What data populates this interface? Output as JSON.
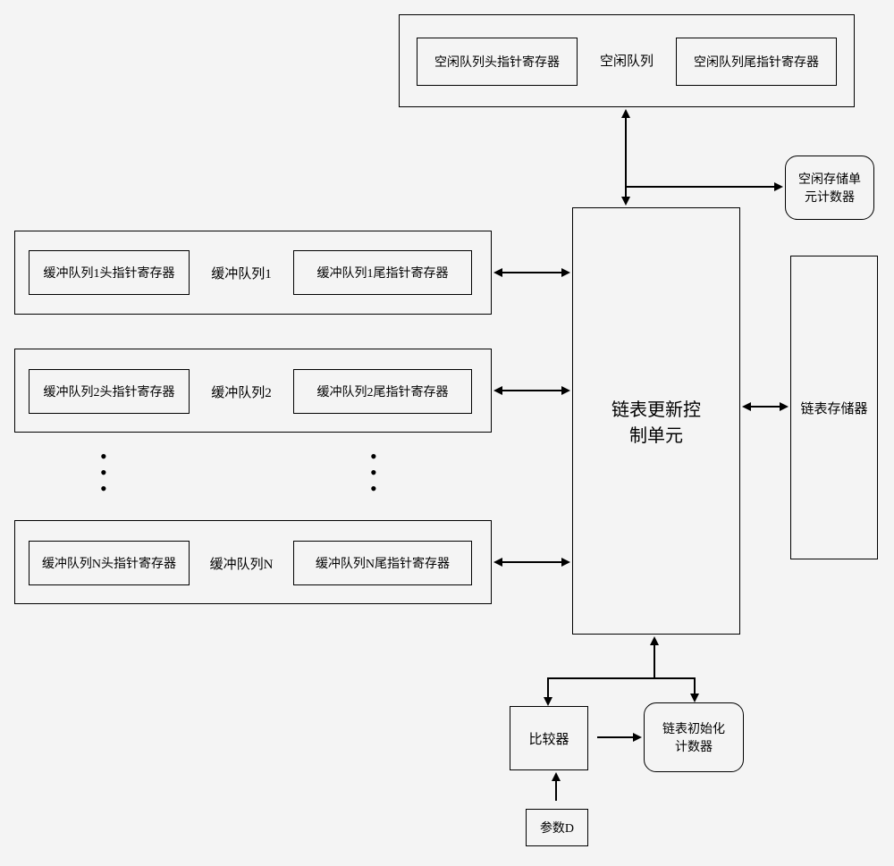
{
  "idleQueue": {
    "container": "",
    "headReg": "空闲队列头指针寄存器",
    "label": "空闲队列",
    "tailReg": "空闲队列尾指针寄存器"
  },
  "bufferQueues": [
    {
      "container": "",
      "headReg": "缓冲队列1头指针寄存器",
      "label": "缓冲队列1",
      "tailReg": "缓冲队列1尾指针寄存器"
    },
    {
      "container": "",
      "headReg": "缓冲队列2头指针寄存器",
      "label": "缓冲队列2",
      "tailReg": "缓冲队列2尾指针寄存器"
    },
    {
      "container": "",
      "headReg": "缓冲队列N头指针寄存器",
      "label": "缓冲队列N",
      "tailReg": "缓冲队列N尾指针寄存器"
    }
  ],
  "controlUnit": "链表更新控\n制单元",
  "idleCounter": "空闲存储单\n元计数器",
  "linkedListStore": "链表存储器",
  "comparator": "比较器",
  "initCounter": "链表初始化\n计数器",
  "paramD": "参数D"
}
